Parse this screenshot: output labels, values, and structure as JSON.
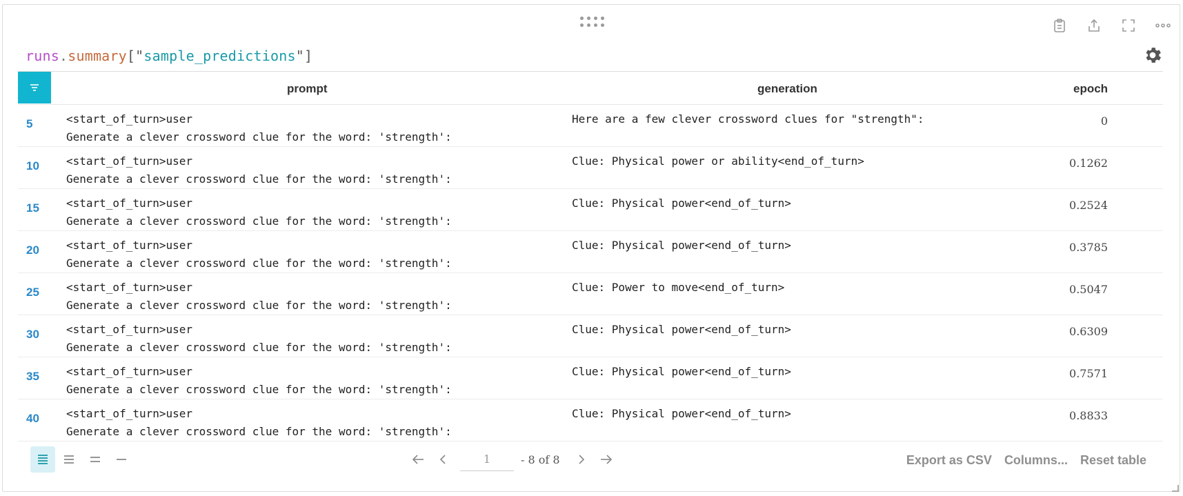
{
  "query": {
    "runs": "runs",
    "dot": ".",
    "summary": "summary",
    "open": "[\"",
    "key": "sample_predictions",
    "close": "\"]"
  },
  "toolbar": {
    "icons": [
      "clipboard-icon",
      "share-icon",
      "fullscreen-icon",
      "more-icon"
    ]
  },
  "table": {
    "columns": {
      "prompt": "prompt",
      "generation": "generation",
      "epoch": "epoch"
    },
    "rows": [
      {
        "index": "5",
        "prompt_line1": "<start_of_turn>user",
        "prompt_line2": "Generate a clever crossword clue for the word: 'strength':",
        "generation": "Here are a few clever crossword clues for \"strength\":",
        "epoch": "0"
      },
      {
        "index": "10",
        "prompt_line1": "<start_of_turn>user",
        "prompt_line2": "Generate a clever crossword clue for the word: 'strength':",
        "generation": "Clue: Physical power or ability<end_of_turn>",
        "epoch": "0.1262"
      },
      {
        "index": "15",
        "prompt_line1": "<start_of_turn>user",
        "prompt_line2": "Generate a clever crossword clue for the word: 'strength':",
        "generation": "Clue: Physical power<end_of_turn>",
        "epoch": "0.2524"
      },
      {
        "index": "20",
        "prompt_line1": "<start_of_turn>user",
        "prompt_line2": "Generate a clever crossword clue for the word: 'strength':",
        "generation": "Clue: Physical power<end_of_turn>",
        "epoch": "0.3785"
      },
      {
        "index": "25",
        "prompt_line1": "<start_of_turn>user",
        "prompt_line2": "Generate a clever crossword clue for the word: 'strength':",
        "generation": "Clue: Power to move<end_of_turn>",
        "epoch": "0.5047"
      },
      {
        "index": "30",
        "prompt_line1": "<start_of_turn>user",
        "prompt_line2": "Generate a clever crossword clue for the word: 'strength':",
        "generation": "Clue: Physical power<end_of_turn>",
        "epoch": "0.6309"
      },
      {
        "index": "35",
        "prompt_line1": "<start_of_turn>user",
        "prompt_line2": "Generate a clever crossword clue for the word: 'strength':",
        "generation": "Clue: Physical power<end_of_turn>",
        "epoch": "0.7571"
      },
      {
        "index": "40",
        "prompt_line1": "<start_of_turn>user",
        "prompt_line2": "Generate a clever crossword clue for the word: 'strength':",
        "generation": "Clue: Physical power<end_of_turn>",
        "epoch": "0.8833"
      }
    ]
  },
  "pagination": {
    "page_value": "1",
    "total_label": "- 8 of 8"
  },
  "actions": {
    "export": "Export as CSV",
    "columns": "Columns...",
    "reset": "Reset table"
  },
  "colors": {
    "accent": "#12b5cf",
    "index_link": "#2a88c8"
  }
}
